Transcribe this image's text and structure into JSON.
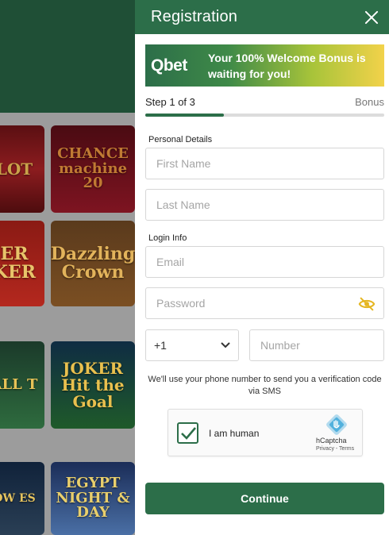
{
  "background": {
    "tiles": [
      "LOT",
      "CHANCE machine 20",
      "ER KER",
      "Dazzling Crown",
      "ALL T",
      "JOKER Hit the Goal",
      "OW ES",
      "EGYPT NIGHT & DAY"
    ]
  },
  "registration": {
    "title": "Registration",
    "close_icon": "close-icon",
    "banner": {
      "logo": "Qbet",
      "text": "Your 100% Welcome Bonus is waiting for you!"
    },
    "step": {
      "label": "Step 1 of 3",
      "next_label": "Bonus",
      "progress": 0.33
    },
    "personal_details": {
      "heading": "Personal Details",
      "first_name_placeholder": "First Name",
      "last_name_placeholder": "Last Name"
    },
    "login_info": {
      "heading": "Login Info",
      "email_placeholder": "Email",
      "password_placeholder": "Password",
      "password_toggle_icon": "eye-off-icon"
    },
    "phone": {
      "country_code": "+1",
      "number_placeholder": "Number"
    },
    "sms_note": "We'll use your phone number to send you a verification code via SMS",
    "captcha": {
      "label": "I am human",
      "checked": true,
      "brand": "hCaptcha",
      "links": "Privacy - Terms"
    },
    "continue_label": "Continue"
  },
  "colors": {
    "brand_green": "#2c6e49",
    "accent_yellow": "#f2d24a"
  }
}
